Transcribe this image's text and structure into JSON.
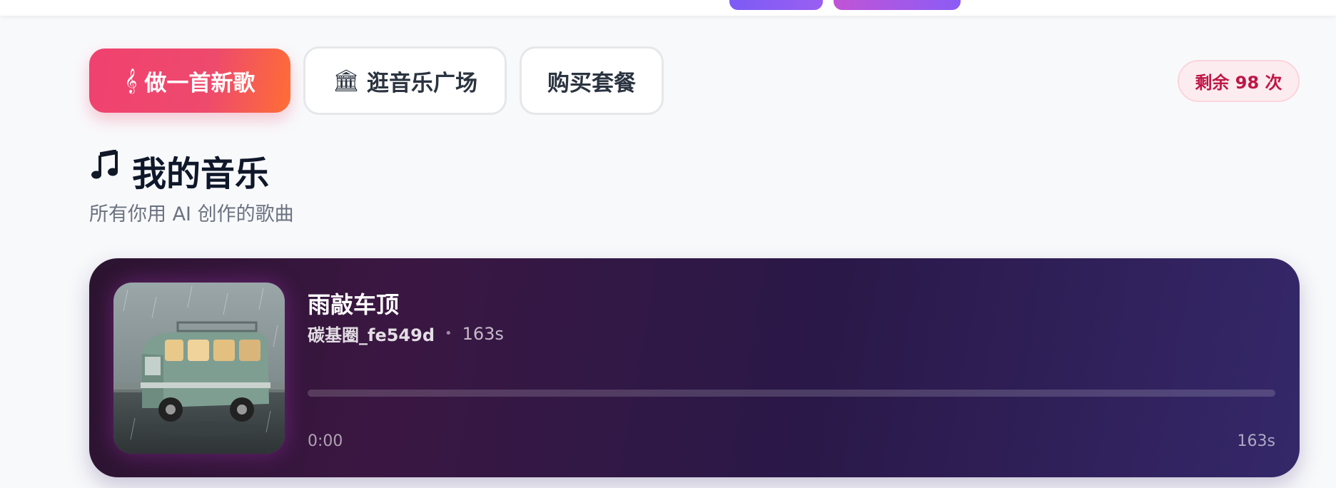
{
  "nav": {
    "create_label": "做一首新歌",
    "create_icon": "treble-clef-icon",
    "plaza_label": "逛音乐广场",
    "plaza_icon": "classical-building-icon",
    "buy_label": "购买套餐"
  },
  "quota": {
    "text": "剩余 98 次"
  },
  "page": {
    "title": "我的音乐",
    "title_icon": "music-notes-icon",
    "subtitle": "所有你用 AI 创作的歌曲"
  },
  "songs": [
    {
      "title": "雨敲车顶",
      "author": "碳基圈_fe549d",
      "duration": "163s",
      "current_time": "0:00",
      "progress": 0,
      "cover_icon": "camper-van-in-rain-image"
    }
  ],
  "colors": {
    "accent_pink": "#f0416f",
    "accent_orange": "#ff6e35",
    "quota_text": "#c01646",
    "card_dark": "#2c1430",
    "card_purple": "#35286a"
  }
}
